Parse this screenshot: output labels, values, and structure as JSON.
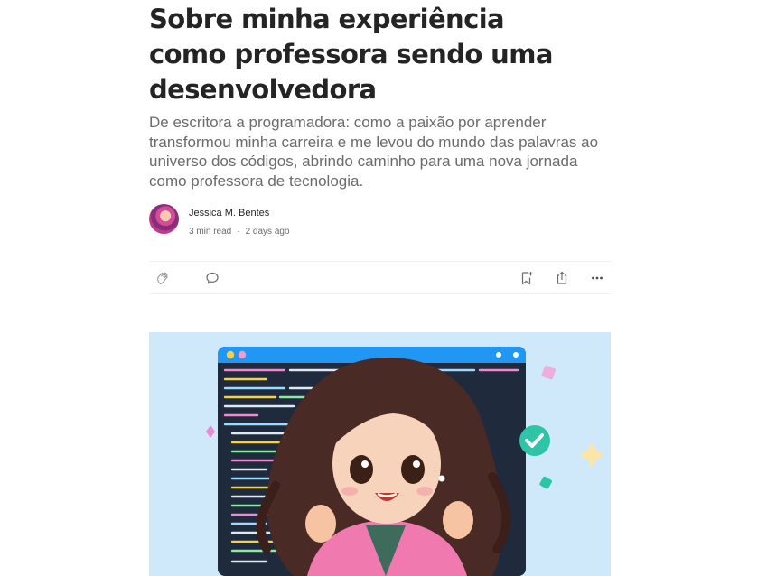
{
  "article": {
    "title": "Sobre minha experiência como professora sendo uma desenvolvedora",
    "subtitle": "De escritora a programadora: como a paixão por aprender transformou minha carreira e me levou do mundo das palavras ao universo dos códigos, abrindo caminho para uma nova jornada como professora de tecnologia."
  },
  "author": {
    "name": "Jessica M. Bentes",
    "read_time": "3 min read",
    "separator": "·",
    "published": "2 days ago"
  },
  "actions": {
    "clap_icon": "clap-icon",
    "comment_icon": "comment-icon",
    "save_icon": "bookmark-add-icon",
    "share_icon": "share-icon",
    "more_icon": "more-icon"
  },
  "colors": {
    "text": "#242424",
    "muted": "#6b6b6b",
    "hero_bg": "#cfe9fb",
    "editor_bar": "#2196f3",
    "editor_bg": "#1f2a3c",
    "check_green": "#2ec4a6",
    "jacket_pink": "#f07ab0"
  }
}
